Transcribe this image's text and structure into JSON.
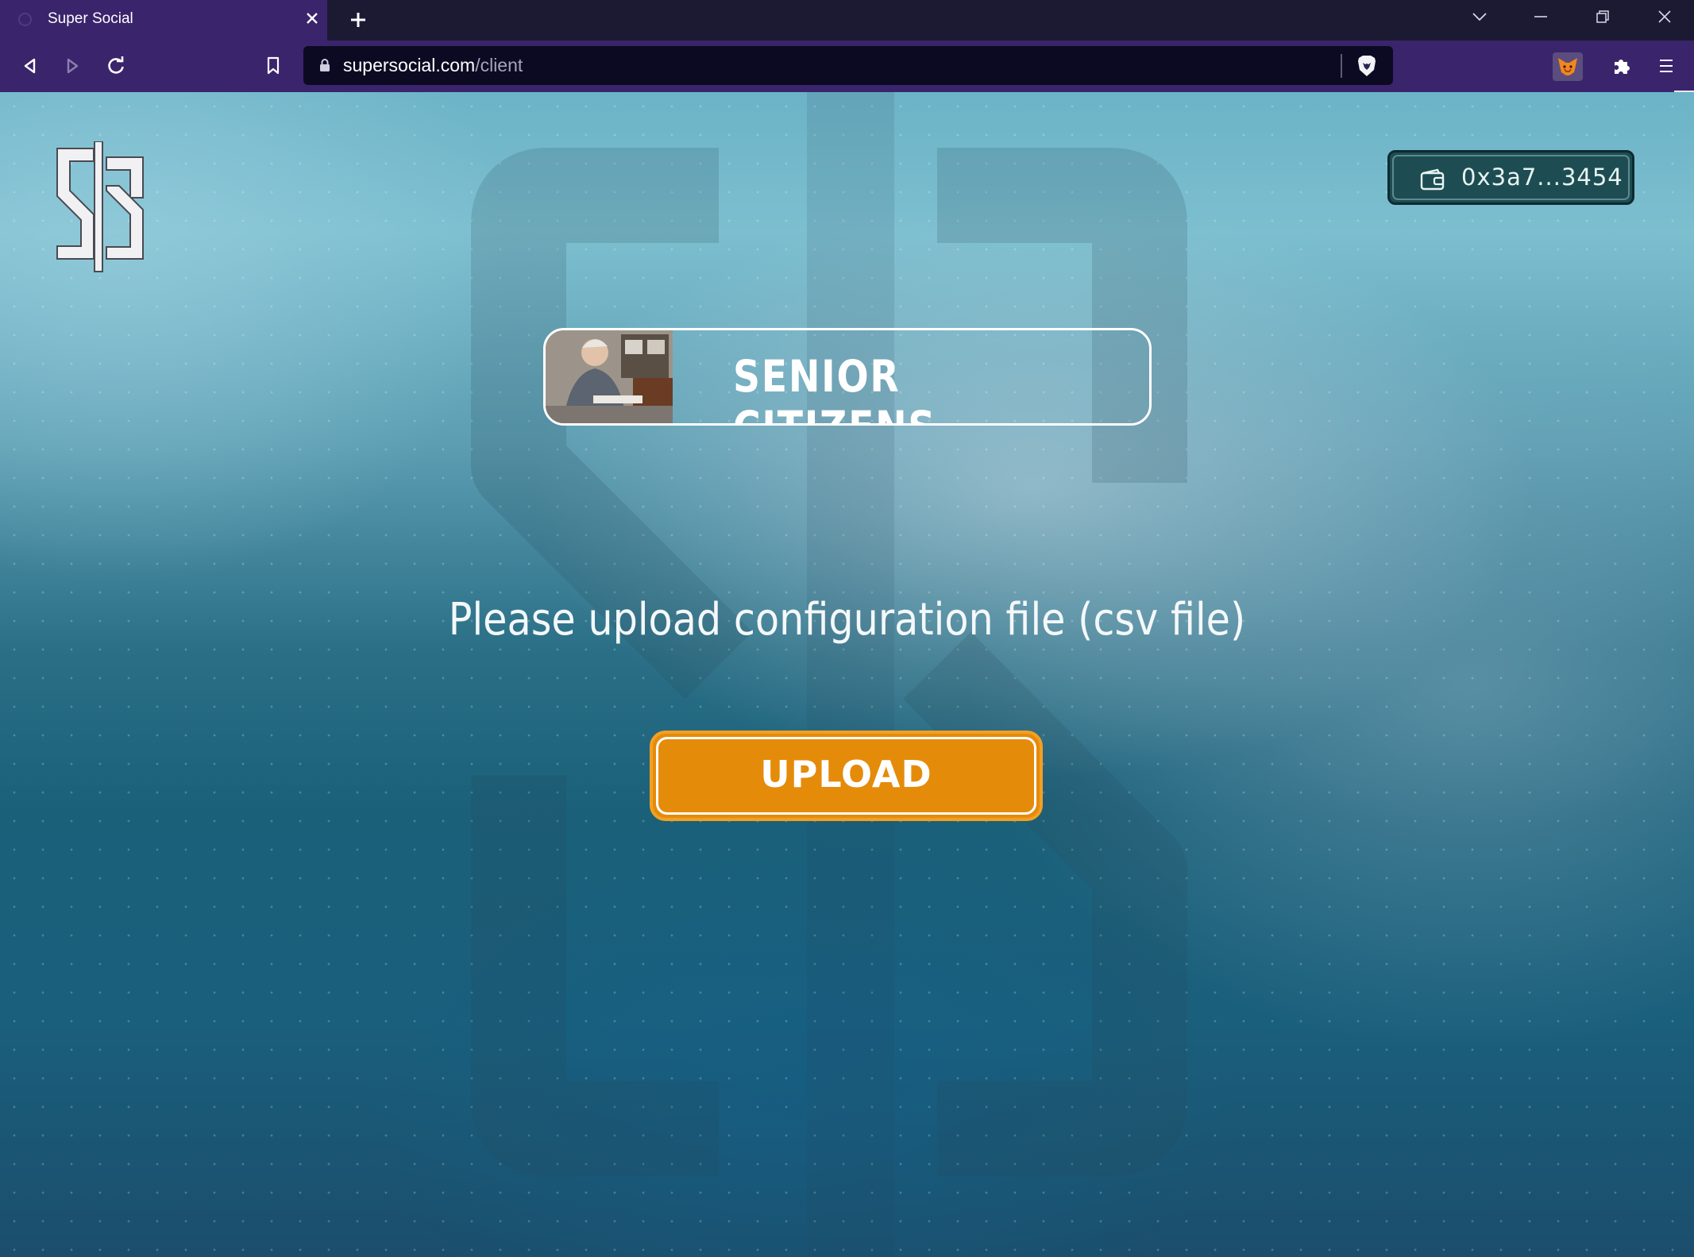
{
  "browser": {
    "tab_title": "Super Social",
    "url_host": "supersocial.com",
    "url_path": "/client",
    "icons": [
      "close-icon",
      "plus-icon",
      "chevron-down-icon",
      "minimize-icon",
      "restore-icon",
      "window-close-icon",
      "back-icon",
      "forward-icon",
      "reload-icon",
      "bookmark-icon",
      "lock-icon",
      "brave-shield-icon",
      "metamask-fox-icon",
      "puzzle-icon",
      "menu-icon"
    ]
  },
  "header": {
    "logo_alt": "S",
    "wallet_address": "0x3a7...3454"
  },
  "main": {
    "category_label": "SENIOR CITIZENS",
    "prompt": "Please upload configuration file (csv file)",
    "upload_label": "UPLOAD"
  },
  "colors": {
    "accent": "#e58b0a",
    "tab": "#3a246c",
    "wallet_bg": "#1d4d52"
  }
}
